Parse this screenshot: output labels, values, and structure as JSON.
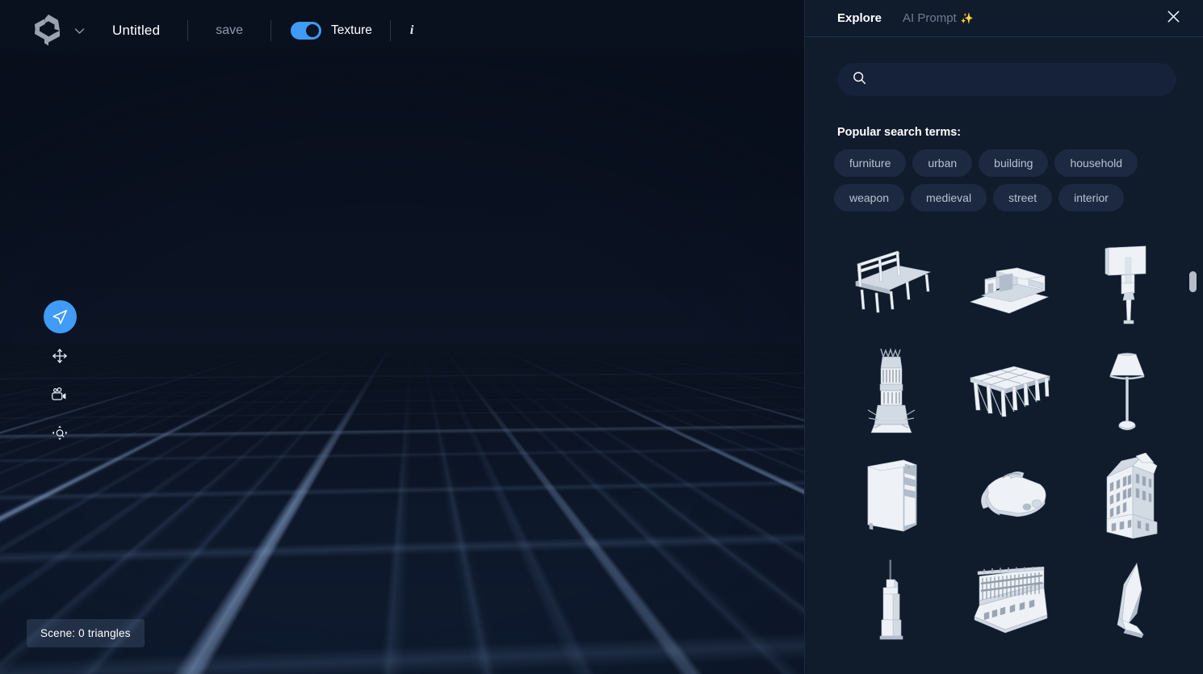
{
  "app": {
    "logo_icon": "triskelion-logo-icon",
    "logo_dropdown_icon": "chevron-down-icon"
  },
  "toolbar": {
    "document_title": "Untitled",
    "save_label": "save",
    "texture_label": "Texture",
    "texture_enabled": true,
    "info_label": "i",
    "accent_color": "#3f9bf5"
  },
  "viewport": {
    "status_text": "Scene: 0 triangles",
    "background_color": "#0b1322",
    "grid_line_color": "#96b4e1",
    "tools": [
      {
        "name": "navigate-tool",
        "icon": "navigate-arrow-icon",
        "active": true
      },
      {
        "name": "move-tool",
        "icon": "move-arrows-icon",
        "active": false
      },
      {
        "name": "camera-tool",
        "icon": "video-camera-icon",
        "active": false
      },
      {
        "name": "zoom-fit-tool",
        "icon": "zoom-fit-icon",
        "active": false
      }
    ]
  },
  "panel": {
    "tabs": [
      {
        "label": "Explore",
        "active": true
      },
      {
        "label": "AI Prompt",
        "sparkle": "✨",
        "active": false
      }
    ],
    "close_icon": "close-icon",
    "search": {
      "value": "",
      "placeholder": "",
      "icon": "search-icon"
    },
    "popular_title": "Popular search terms:",
    "tags": [
      "furniture",
      "urban",
      "building",
      "household",
      "weapon",
      "medieval",
      "street",
      "interior"
    ],
    "results": [
      {
        "name": "long-bench",
        "shape": "bench"
      },
      {
        "name": "warehouse-building",
        "shape": "warehouse"
      },
      {
        "name": "billboard-sign",
        "shape": "billboard"
      },
      {
        "name": "medieval-tower",
        "shape": "tower"
      },
      {
        "name": "stage-platform-table",
        "shape": "platform"
      },
      {
        "name": "floor-lamp",
        "shape": "lamp"
      },
      {
        "name": "pc-tower-case",
        "shape": "pc"
      },
      {
        "name": "vr-headset",
        "shape": "headset"
      },
      {
        "name": "townhouse",
        "shape": "townhouse"
      },
      {
        "name": "skyscraper",
        "shape": "skyscraper"
      },
      {
        "name": "classical-facade",
        "shape": "facade"
      },
      {
        "name": "crystal-blade",
        "shape": "crystal"
      }
    ]
  }
}
